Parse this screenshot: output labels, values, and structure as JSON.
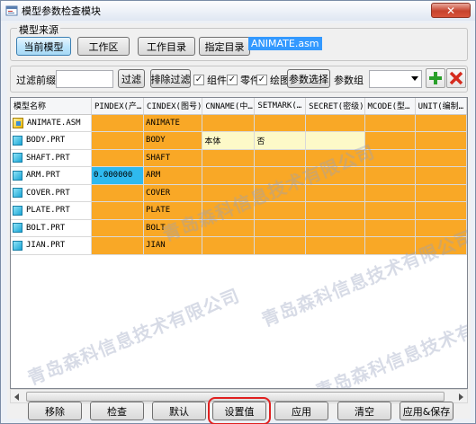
{
  "window": {
    "title": "模型参数检查模块",
    "close_label": "✕"
  },
  "source_group": {
    "label": "模型来源",
    "buttons": [
      "当前模型",
      "工作区",
      "工作目录",
      "指定目录"
    ],
    "model_value": "ANIMATE.asm"
  },
  "filter_bar": {
    "label": "过滤前缀",
    "input_value": "",
    "filter_button": "过滤",
    "exclude_button": "排除过滤",
    "checks": [
      {
        "label": "组件",
        "checked": true
      },
      {
        "label": "零件",
        "checked": true
      },
      {
        "label": "绘图",
        "checked": true
      }
    ],
    "param_select_button": "参数选择",
    "param_group_label": "参数组",
    "param_group_value": "",
    "add_icon": "plus-icon",
    "delete_icon": "delete-x-icon"
  },
  "grid": {
    "columns": [
      "模型名称",
      "PINDEX(产…",
      "CINDEX(图号)",
      "CNNAME(中…",
      "SETMARK(…",
      "SECRET(密级)",
      "MCODE(型…",
      "UNIT(编制…"
    ],
    "rows": [
      {
        "name": "ANIMATE.ASM",
        "icon": "assembly-icon",
        "cells": [
          "",
          "ANIMATE",
          "",
          "",
          "",
          "",
          ""
        ]
      },
      {
        "name": "BODY.PRT",
        "icon": "part-icon",
        "cells": [
          "",
          "BODY",
          "本体",
          "否",
          "",
          "",
          ""
        ]
      },
      {
        "name": "SHAFT.PRT",
        "icon": "part-icon",
        "cells": [
          "",
          "SHAFT",
          "",
          "",
          "",
          "",
          ""
        ]
      },
      {
        "name": "ARM.PRT",
        "icon": "part-icon",
        "cells": [
          "0.000000",
          "ARM",
          "",
          "",
          "",
          "",
          ""
        ]
      },
      {
        "name": "COVER.PRT",
        "icon": "part-icon",
        "cells": [
          "",
          "COVER",
          "",
          "",
          "",
          "",
          ""
        ]
      },
      {
        "name": "PLATE.PRT",
        "icon": "part-icon",
        "cells": [
          "",
          "PLATE",
          "",
          "",
          "",
          "",
          ""
        ]
      },
      {
        "name": "BOLT.PRT",
        "icon": "part-icon",
        "cells": [
          "",
          "BOLT",
          "",
          "",
          "",
          "",
          ""
        ]
      },
      {
        "name": "JIAN.PRT",
        "icon": "part-icon",
        "cells": [
          "",
          "JIAN",
          "",
          "",
          "",
          "",
          ""
        ]
      }
    ],
    "cell_colors": {
      "orange": "#f9a826",
      "pale_yellow": "#fdf9c8",
      "blue": "#2fb9ee"
    }
  },
  "bottom_buttons": [
    "移除",
    "检查",
    "默认",
    "设置值",
    "应用",
    "清空",
    "应用&保存"
  ],
  "watermark_text": "青岛森科信息技术有限公司"
}
